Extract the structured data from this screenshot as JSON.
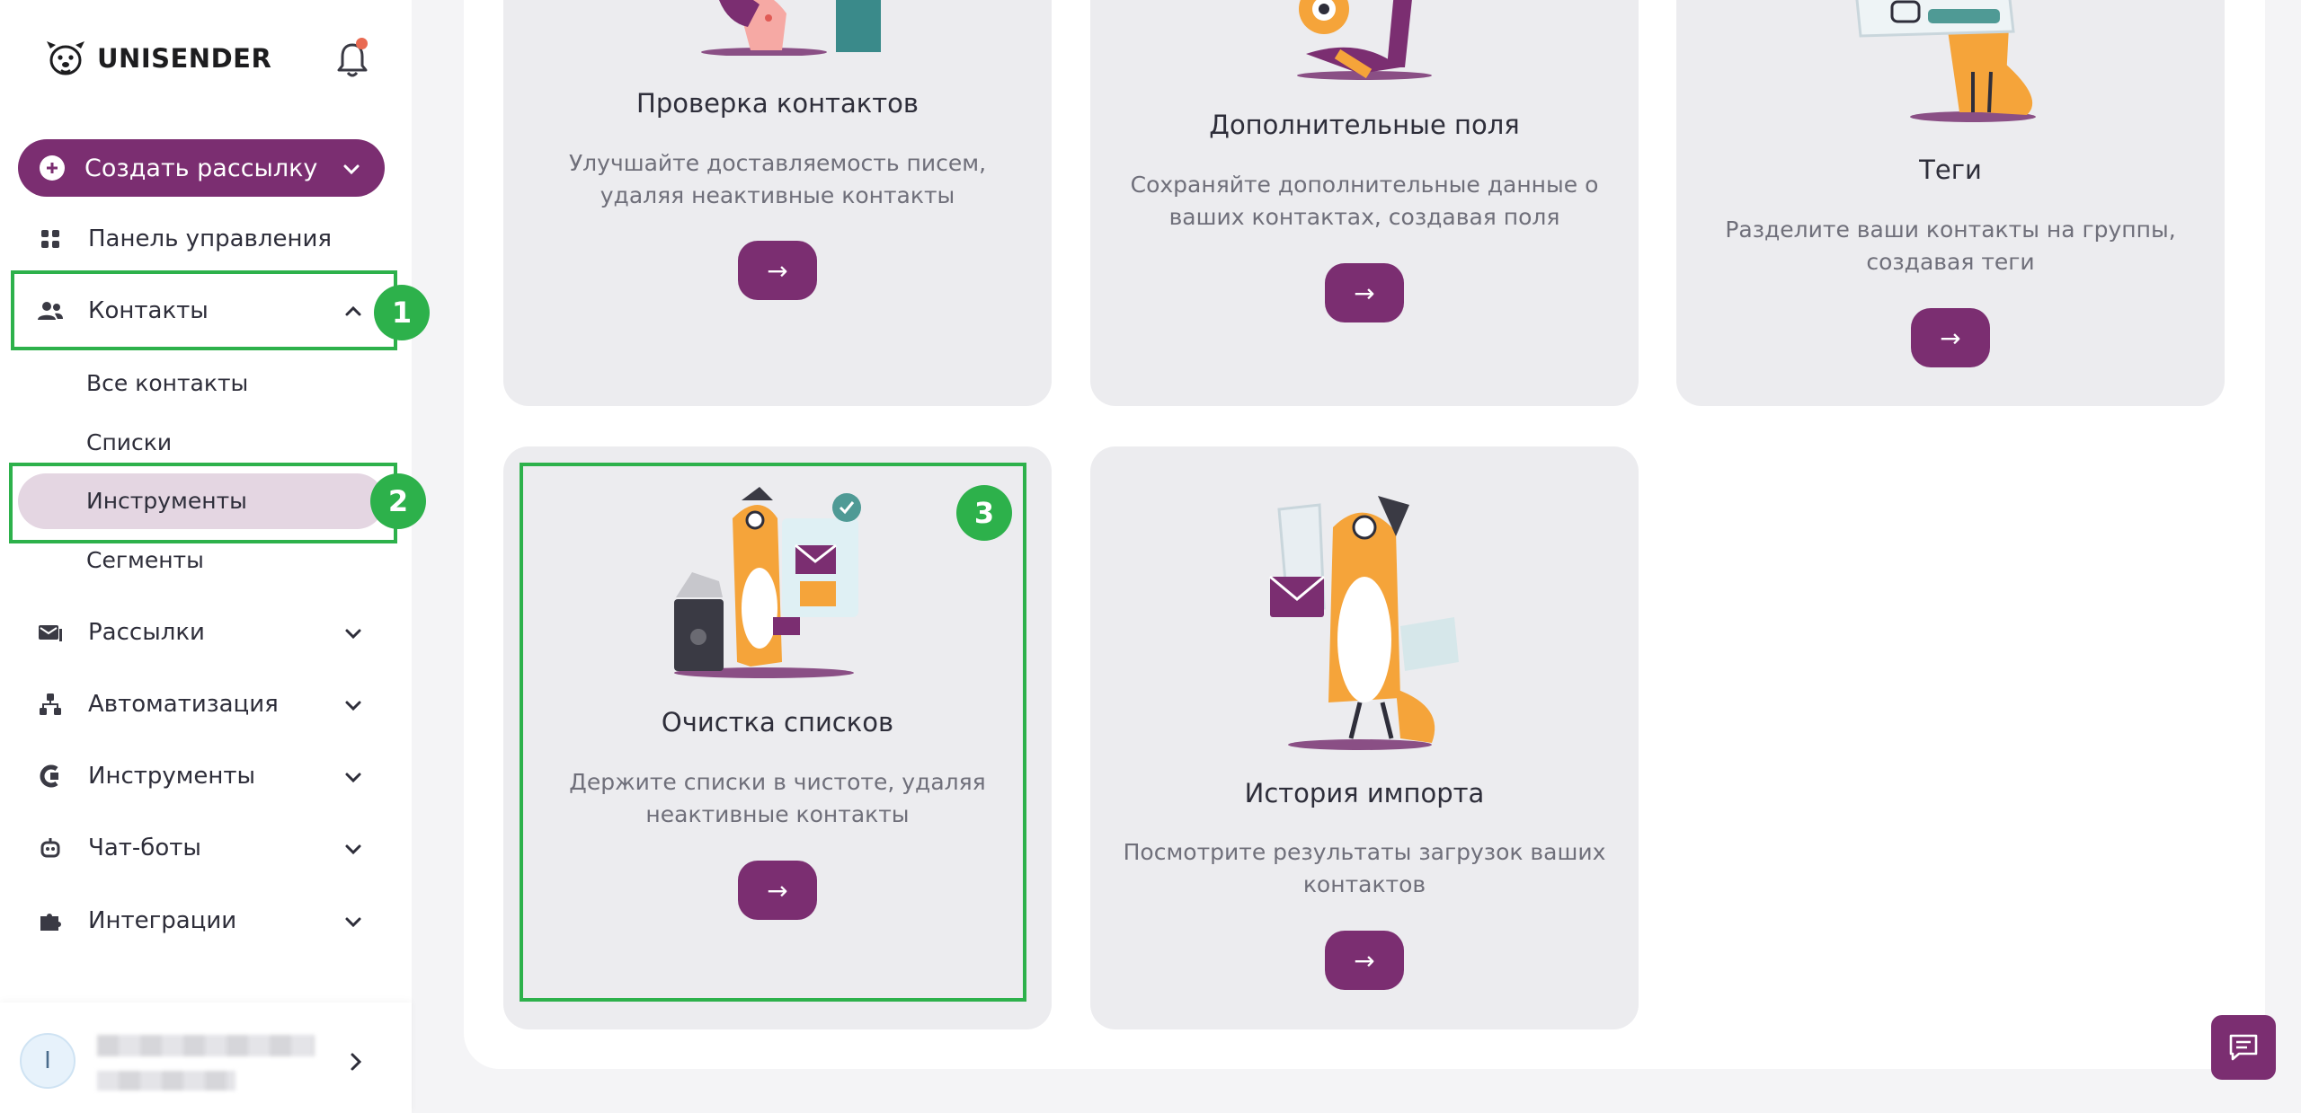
{
  "brand": {
    "name": "UNISENDER",
    "accent": "#7b2e71",
    "highlight": "#2db14b"
  },
  "sidebar": {
    "create_button": "Создать рассылку",
    "items": [
      {
        "label": "Панель управления",
        "icon": "dashboard-icon"
      },
      {
        "label": "Контакты",
        "icon": "contacts-icon",
        "expanded": true
      },
      {
        "label": "Рассылки",
        "icon": "mail-icon"
      },
      {
        "label": "Автоматизация",
        "icon": "automation-icon"
      },
      {
        "label": "Инструменты",
        "icon": "tools-icon"
      },
      {
        "label": "Чат-боты",
        "icon": "bot-icon"
      },
      {
        "label": "Интеграции",
        "icon": "puzzle-icon"
      }
    ],
    "contacts_sub": [
      {
        "label": "Все контакты"
      },
      {
        "label": "Списки"
      },
      {
        "label": "Инструменты",
        "active": true
      },
      {
        "label": "Сегменты"
      }
    ],
    "user": {
      "avatar_initial": "I"
    }
  },
  "cards": [
    {
      "title": "Проверка контактов",
      "desc": "Улучшайте доставляемость писем, удаляя неактивные контакты",
      "button": "→"
    },
    {
      "title": "Дополнительные поля",
      "desc": "Сохраняйте дополнительные данные о ваших контактах, создавая поля",
      "button": "→"
    },
    {
      "title": "Теги",
      "desc": "Разделите ваши контакты на группы, создавая теги",
      "button": "→"
    },
    {
      "title": "Очистка списков",
      "desc": "Держите списки в чистоте, удаляя неактивные контакты",
      "button": "→"
    },
    {
      "title": "История импорта",
      "desc": "Посмотрите результаты загрузок ваших контактов",
      "button": "→"
    }
  ],
  "annotations": [
    "1",
    "2",
    "3"
  ]
}
